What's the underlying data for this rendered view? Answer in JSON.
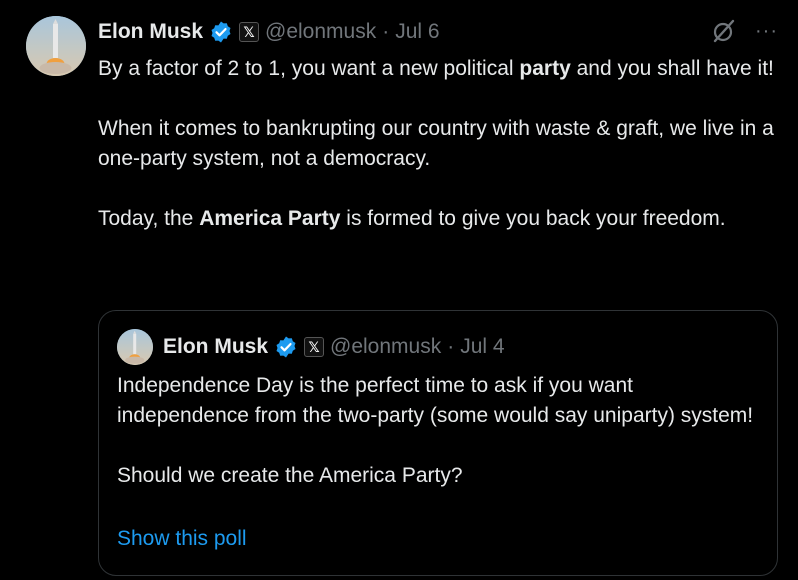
{
  "tweet": {
    "author_name": "Elon Musk",
    "handle": "@elonmusk",
    "separator": "·",
    "date": "Jul 6",
    "paragraphs": [
      {
        "parts": [
          "By a factor of 2 to 1, you want a new political ",
          "party",
          " and you shall have it!"
        ]
      },
      {
        "text": "When it comes to bankrupting our country with waste & graft, we live in a one-party system, not a democracy."
      },
      {
        "parts": [
          "Today, the ",
          "America Party",
          " is formed to give you back your freedom."
        ]
      }
    ],
    "more_label": "···"
  },
  "quote": {
    "author_name": "Elon Musk",
    "handle": "@elonmusk",
    "separator": "·",
    "date": "Jul 4",
    "paragraph1": "Independence Day is the perfect time to ask if you want independence from the two-party (some would say uniparty) system!",
    "paragraph2": "Should we create the America Party?",
    "show_poll_label": "Show this poll"
  },
  "badge": {
    "x_glyph": "𝕏"
  },
  "colors": {
    "link": "#1d9bf0",
    "verified": "#1d9bf0",
    "muted": "#71767b",
    "text": "#e7e9ea"
  },
  "icons": [
    "verified-badge-icon",
    "x-affiliate-badge-icon",
    "grok-icon",
    "more-options-icon"
  ]
}
